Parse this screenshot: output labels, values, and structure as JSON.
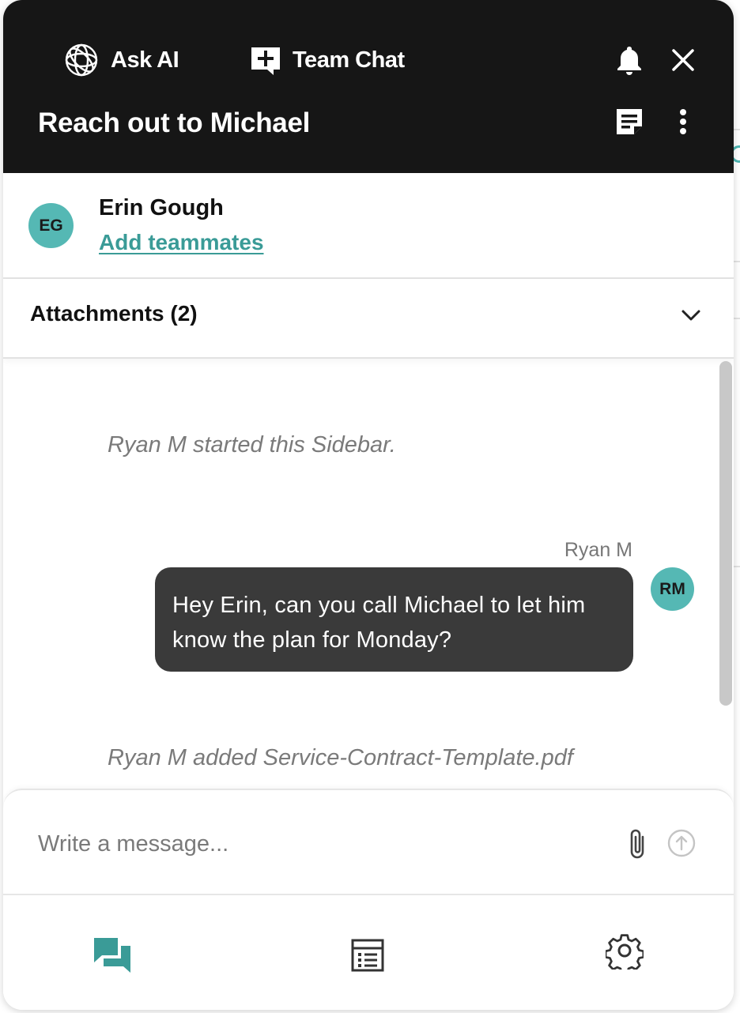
{
  "header": {
    "nav": {
      "ask_ai": "Ask AI",
      "team_chat": "Team Chat"
    },
    "title": "Reach out to Michael",
    "icons": [
      "ask-ai-logo-icon",
      "new-chat-icon",
      "bell-icon",
      "close-icon",
      "notes-icon",
      "more-vertical-icon"
    ]
  },
  "members": {
    "avatar_initials": "EG",
    "name": "Erin Gough",
    "add_link": "Add teammates"
  },
  "attachments": {
    "label": "Attachments (2)",
    "icon": "chevron-down-icon"
  },
  "messages": {
    "system_1": "Ryan M started this Sidebar.",
    "sender": "Ryan M",
    "sender_initials": "RM",
    "body": "Hey Erin, can you call Michael to let him know the plan for Monday?",
    "system_2": "Ryan M added Service-Contract-Template.pdf"
  },
  "composer": {
    "placeholder": "Write a message...",
    "icons": [
      "paperclip-icon",
      "send-icon"
    ]
  },
  "bottom_nav": {
    "icons": [
      "chat-icon",
      "list-icon",
      "settings-icon"
    ],
    "active": "chat"
  },
  "colors": {
    "header_bg": "#161616",
    "accent": "#3a9b97",
    "avatar_bg": "#55b8b4",
    "bubble_bg": "#3a3a3a"
  }
}
